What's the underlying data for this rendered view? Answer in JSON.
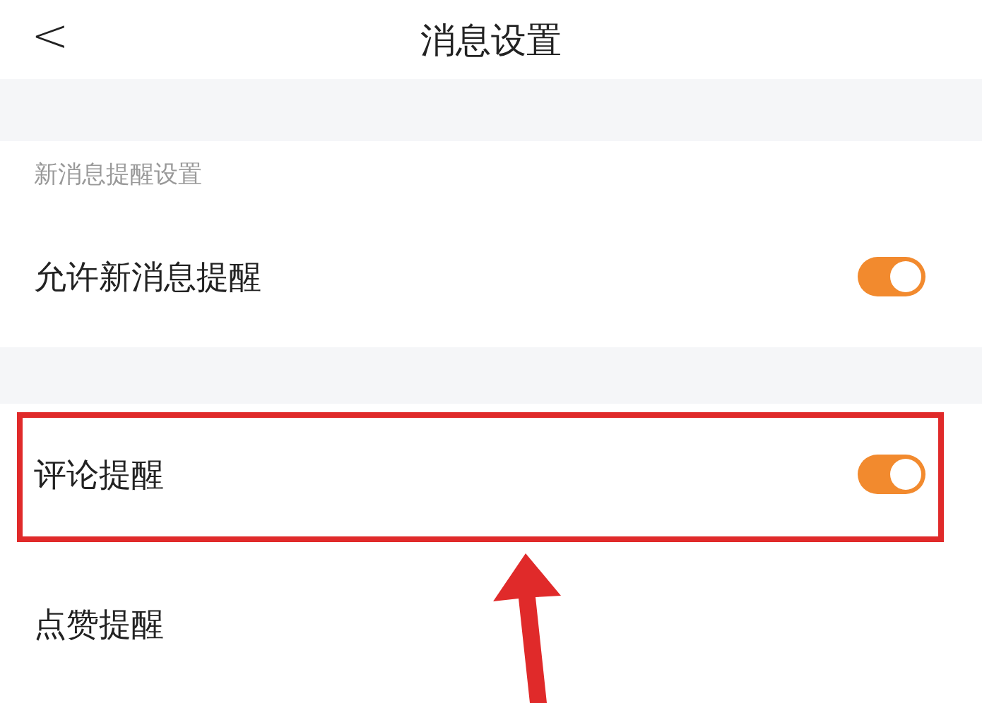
{
  "header": {
    "back": "<",
    "title": "消息设置"
  },
  "section_label": "新消息提醒设置",
  "rows": [
    {
      "label": "允许新消息提醒",
      "on": true
    },
    {
      "label": "评论提醒",
      "on": true,
      "gap_before": true,
      "highlighted": true
    },
    {
      "label": "点赞提醒"
    }
  ]
}
